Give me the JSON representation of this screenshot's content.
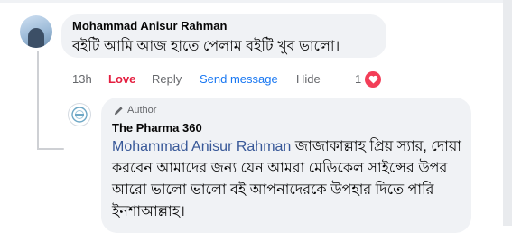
{
  "comment": {
    "author": "Mohammad Anisur Rahman",
    "text": "বইটি আমি আজ হাতে পেলাম বইটি খুব ভালো।",
    "time": "13h",
    "actions": {
      "love": "Love",
      "reply": "Reply",
      "send_message": "Send message",
      "hide": "Hide"
    },
    "reaction": {
      "count": "1",
      "icon": "heart-icon",
      "color": "#f33e58"
    }
  },
  "reply": {
    "badge": "Author",
    "author": "The Pharma 360",
    "mention": "Mohammad Anisur Rahman",
    "text": " জাজাকাল্লাহ প্রিয় স্যার, দোয়া করবেন আমাদের জন্য যেন আমরা মেডিকেল সাইন্সের উপর আরো ভালো ভালো বই আপনাদেরকে উপহার দিতে পারি ইনশাআল্লাহ।"
  },
  "colors": {
    "link": "#1877f2",
    "love": "#e41e3f",
    "mention": "#385898",
    "bubble": "#f0f2f5"
  }
}
